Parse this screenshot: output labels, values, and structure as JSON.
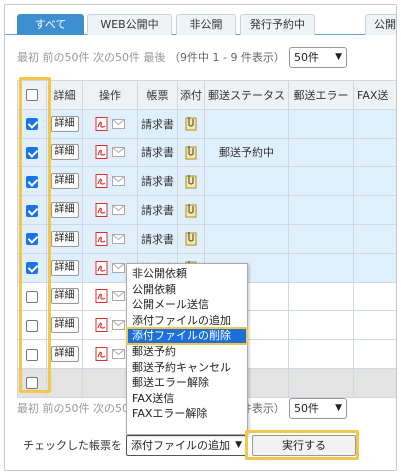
{
  "tabs": [
    "すべて",
    "WEB公開中",
    "非公開",
    "発行予約中",
    "公開"
  ],
  "pager": {
    "links": "最初 前の50件 次の50件 最後",
    "count": "（9件中 1 - 9 件表示）",
    "per_page": "50件"
  },
  "table": {
    "headers": [
      "",
      "詳細",
      "操作",
      "帳票",
      "添付",
      "郵送ステータス",
      "郵送エラー",
      "FAX送"
    ],
    "rows": [
      {
        "checked": true,
        "detail": "詳細",
        "doc": "請求書",
        "status": ""
      },
      {
        "checked": true,
        "detail": "詳細",
        "doc": "請求書",
        "status": "郵送予約中"
      },
      {
        "checked": true,
        "detail": "詳細",
        "doc": "請求書",
        "status": ""
      },
      {
        "checked": true,
        "detail": "詳細",
        "doc": "請求書",
        "status": ""
      },
      {
        "checked": true,
        "detail": "詳細",
        "doc": "請求書",
        "status": ""
      },
      {
        "checked": true,
        "detail": "詳細",
        "doc": "請求書",
        "status": ""
      },
      {
        "checked": false,
        "detail": "詳細",
        "doc": "",
        "status": ""
      },
      {
        "checked": false,
        "detail": "詳細",
        "doc": "",
        "status": ""
      },
      {
        "checked": false,
        "detail": "詳細",
        "doc": "",
        "status": ""
      }
    ]
  },
  "dropdown_options": [
    "非公開依頼",
    "公開依頼",
    "公開メール送信",
    "添付ファイルの追加",
    "添付ファイルの削除",
    "郵送予約",
    "郵送予約キャンセル",
    "郵送エラー解除",
    "FAX送信",
    "FAXエラー解除"
  ],
  "highlighted_option_index": 4,
  "bottom": {
    "label": "チェックした帳票を",
    "selected_action": "添付ファイルの追加",
    "execute_label": "実行する"
  },
  "icons": {
    "pdf": "pdf-icon",
    "mail": "mail-icon",
    "attachment": "clip-icon",
    "chevron": "chevron-down-icon"
  },
  "colors": {
    "tab_active": "#3e8fd1",
    "selected_row": "#e0effc",
    "highlight_border": "#f4c64c",
    "option_highlight": "#1e6fd9",
    "checkbox_on": "#1a73e8",
    "pdf_red": "#d9302c"
  }
}
